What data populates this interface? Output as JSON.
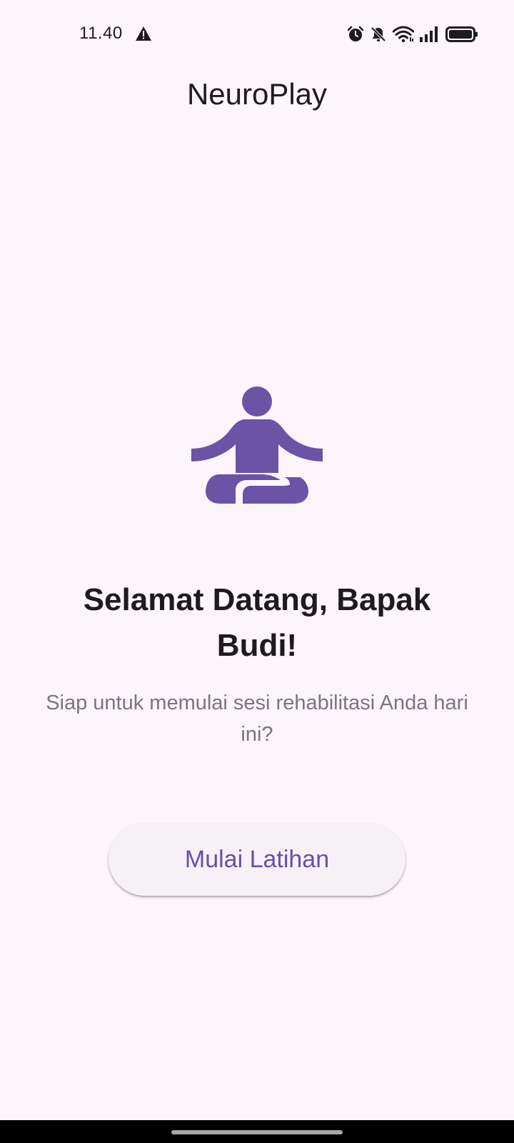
{
  "status_bar": {
    "time": "11.40",
    "icons": [
      "warning-icon",
      "alarm-icon",
      "notifications-off-icon",
      "wifi-icon",
      "signal-icon",
      "battery-icon"
    ]
  },
  "app_bar": {
    "title": "NeuroPlay"
  },
  "hero": {
    "icon": "meditation-icon",
    "icon_color": "#6b53a6"
  },
  "welcome": {
    "title": "Selamat Datang, Bapak Budi!",
    "subtitle": "Siap untuk memulai sesi rehabilitasi Anda hari ini?"
  },
  "actions": {
    "start_label": "Mulai Latihan"
  },
  "colors": {
    "background": "#fcf5fc",
    "accent": "#6750a4",
    "button_bg": "#f6f1f7",
    "subtitle_text": "#7a757f"
  }
}
